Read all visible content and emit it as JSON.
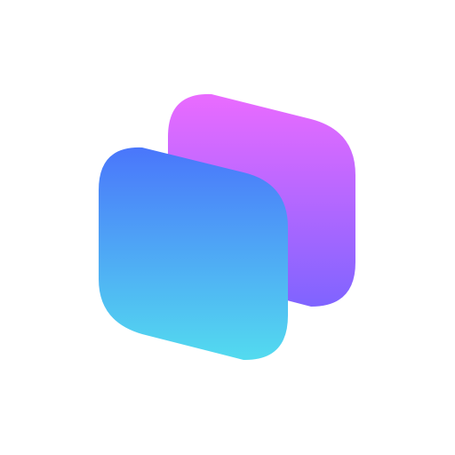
{
  "logo": {
    "icon": "stacked-cards-icon",
    "background_color": "#ffffff",
    "back_card": {
      "gradient_top": "#ea6bff",
      "gradient_bottom": "#7f64ff"
    },
    "front_card": {
      "gradient_top": "#4a76fb",
      "gradient_bottom": "#53dbef"
    }
  }
}
